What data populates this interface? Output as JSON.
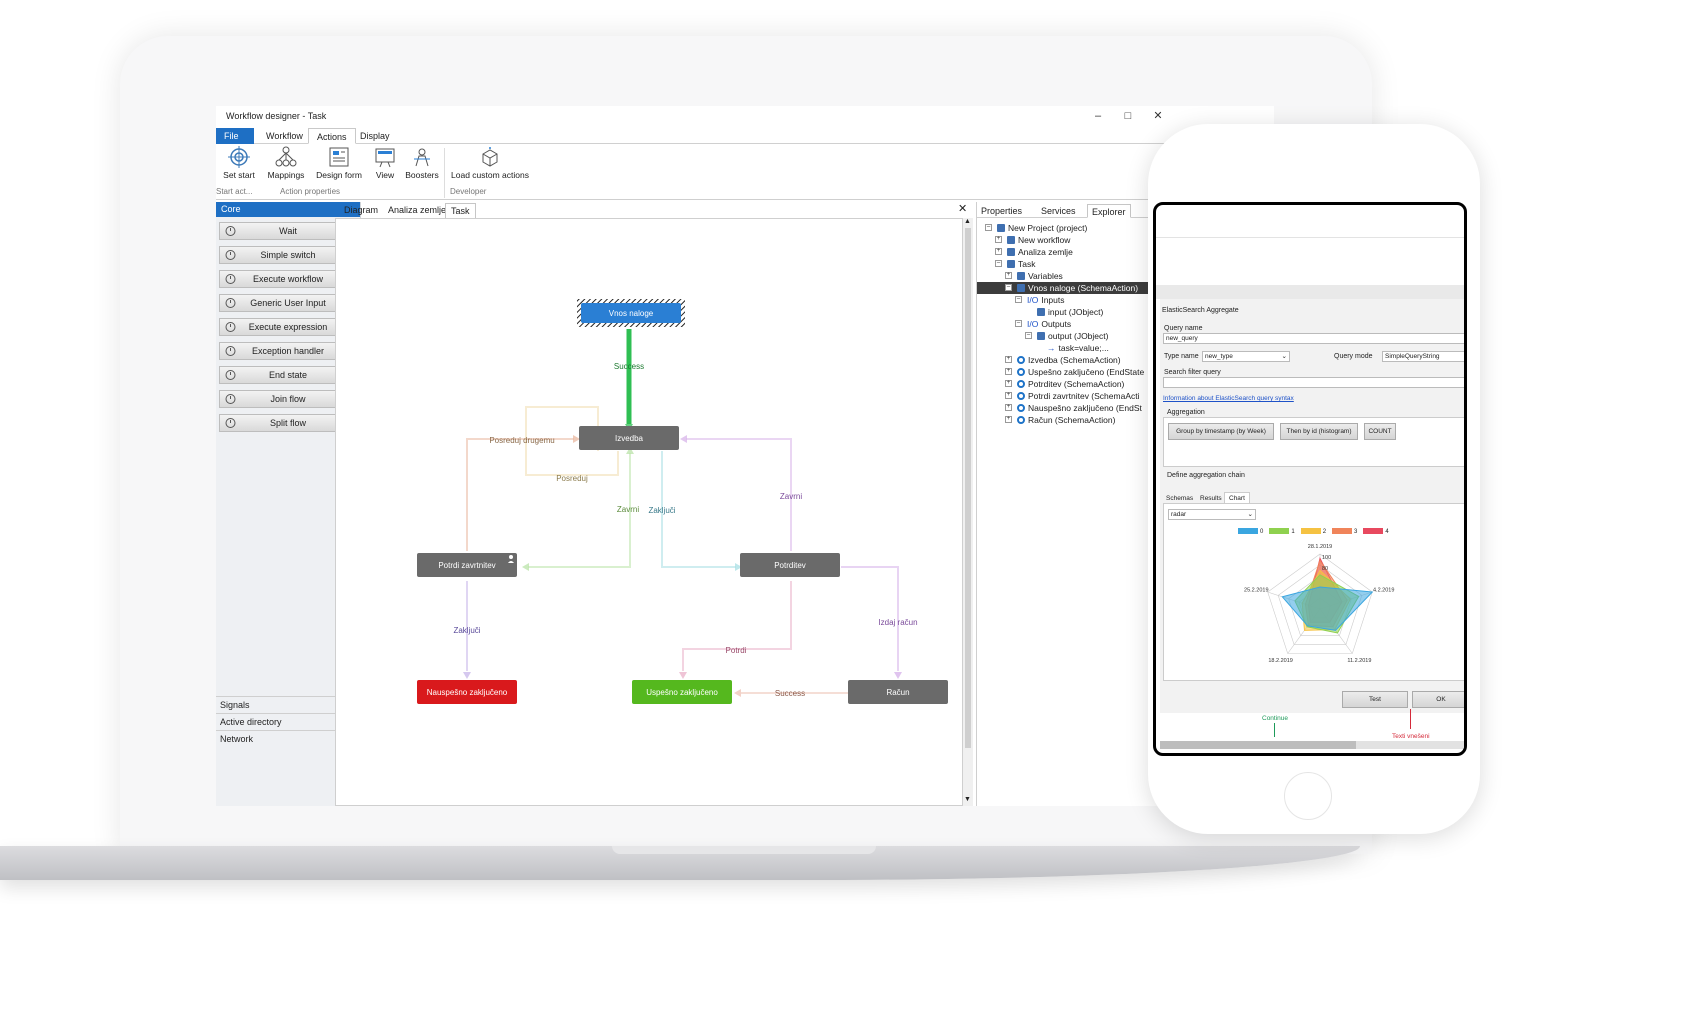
{
  "window": {
    "title": "Workflow designer - Task",
    "min": "–",
    "max": "□",
    "close": "✕"
  },
  "menu_tabs": [
    "File",
    "Workflow",
    "Actions",
    "Display"
  ],
  "ribbon": {
    "buttons": [
      {
        "label": "Set start",
        "icon": "target-icon"
      },
      {
        "label": "Mappings",
        "icon": "mappings-icon"
      },
      {
        "label": "Design form",
        "icon": "design-form-icon"
      },
      {
        "label": "View",
        "icon": "view-icon"
      },
      {
        "label": "Boosters",
        "icon": "boosters-icon"
      },
      {
        "label": "Load custom actions",
        "icon": "package-icon"
      }
    ],
    "groups": [
      "Start act...",
      "Action properties",
      "Developer"
    ]
  },
  "toolbox": {
    "header": "Core",
    "items": [
      "Wait",
      "Simple switch",
      "Execute workflow",
      "Generic User Input",
      "Execute expression",
      "Exception handler",
      "End state",
      "Join flow",
      "Split flow"
    ],
    "sections": [
      "Signals",
      "Active directory",
      "Network"
    ]
  },
  "doc_tabs": [
    "Diagram",
    "Analiza zemlje",
    "Task"
  ],
  "diagram": {
    "nodes": {
      "vnos": "Vnos naloge",
      "izvedba": "Izvedba",
      "potrdi_zavrtnitev": "Potrdi zavrtnitev",
      "potrditev": "Potrditev",
      "nauspesno": "Nauspešno zaključeno",
      "uspesno": "Uspešno zaključeno",
      "racun": "Račun"
    },
    "edges": {
      "success1": "Success",
      "posreduj_drugemu": "Posreduj drugemu",
      "posreduj": "Posreduj",
      "zavrni1": "Zavrni",
      "zakljuci1": "Zaključi",
      "zavrni2": "Zavrni",
      "zakljuci2": "Zaključi",
      "potrdi": "Potrdi",
      "izdaj_racun": "Izdaj račun",
      "success2": "Success"
    },
    "colors": {
      "start": "#2a7fd4",
      "node": "#6a6a6a",
      "fail": "#d9191c",
      "ok": "#55b81e"
    }
  },
  "right_panel": {
    "tabs": [
      "Properties",
      "Services",
      "Explorer"
    ],
    "tree": [
      {
        "label": "New Project (project)",
        "level": 0,
        "exp": "–"
      },
      {
        "label": "New workflow",
        "level": 1,
        "exp": "+"
      },
      {
        "label": "Analiza zemlje",
        "level": 1,
        "exp": "+"
      },
      {
        "label": "Task",
        "level": 1,
        "exp": "–"
      },
      {
        "label": "Variables",
        "level": 2,
        "exp": "+"
      },
      {
        "label": "Vnos naloge (SchemaAction)",
        "level": 2,
        "exp": "–",
        "selected": true
      },
      {
        "label": "Inputs",
        "level": 3,
        "exp": "–",
        "prefix": "I/O"
      },
      {
        "label": "input (JObject)",
        "level": 4,
        "exp": ""
      },
      {
        "label": "Outputs",
        "level": 3,
        "exp": "–",
        "prefix": "I/O"
      },
      {
        "label": "output (JObject)",
        "level": 4,
        "exp": "–"
      },
      {
        "label": "task=value;...",
        "level": 5,
        "exp": "",
        "prefix": "→"
      },
      {
        "label": "Izvedba (SchemaAction)",
        "level": 2,
        "exp": "+"
      },
      {
        "label": "Uspešno zaključeno (EndState",
        "level": 2,
        "exp": "+"
      },
      {
        "label": "Potrditev (SchemaAction)",
        "level": 2,
        "exp": "+"
      },
      {
        "label": "Potrdi zavrtnitev (SchemaActi",
        "level": 2,
        "exp": "+"
      },
      {
        "label": "Nauspešno zaključeno (EndSt",
        "level": 2,
        "exp": "+"
      },
      {
        "label": "Račun (SchemaAction)",
        "level": 2,
        "exp": "+"
      }
    ]
  },
  "phone": {
    "title": "ElasticSearch Aggregate",
    "query_name_label": "Query name",
    "query_name_value": "new_query",
    "type_name_label": "Type name",
    "type_name_value": "new_type",
    "query_mode_label": "Query mode",
    "query_mode_value": "SimpleQueryString",
    "search_filter_label": "Search filter query",
    "info_link": "Information about ElasticSearch  query syntax",
    "aggregation_label": "Aggregation",
    "agg_buttons": [
      "Group by timestamp (by Week)",
      "Then by id (histogram)",
      "COUNT"
    ],
    "chain_label": "Define aggregation chain",
    "tabs": [
      "Schemas",
      "Results",
      "Chart"
    ],
    "chart_type": "radar",
    "buttons": {
      "test": "Test",
      "ok": "OK"
    },
    "bottom_labels": {
      "continue": "Continue",
      "texti": "Texti vnešeni"
    }
  },
  "chart_data": {
    "type": "radar",
    "axes": [
      "28.1.2019",
      "4.2.2019",
      "11.2.2019",
      "18.2.2019",
      "25.2.2019"
    ],
    "ticks": [
      "100",
      "80"
    ],
    "rmax": 100,
    "series": [
      {
        "name": "0",
        "color": "#3aa6e0",
        "values": [
          40,
          100,
          48,
          38,
          72
        ]
      },
      {
        "name": "1",
        "color": "#8fd14f",
        "values": [
          62,
          74,
          54,
          40,
          48
        ]
      },
      {
        "name": "2",
        "color": "#f5c242",
        "values": [
          70,
          58,
          46,
          48,
          34
        ]
      },
      {
        "name": "3",
        "color": "#f0845a",
        "values": [
          88,
          52,
          40,
          36,
          28
        ]
      },
      {
        "name": "4",
        "color": "#e8495f",
        "values": [
          92,
          42,
          30,
          30,
          22
        ]
      }
    ]
  }
}
